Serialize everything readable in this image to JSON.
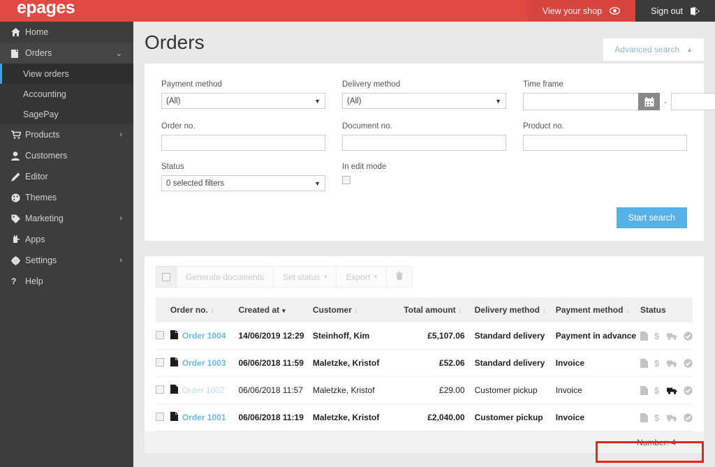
{
  "topbar": {
    "logo": "epages",
    "view_shop": "View your shop",
    "view_shop_icon": "eye-icon",
    "sign_out": "Sign out",
    "sign_out_icon": "sign-out-icon",
    "bg_color": "#e04a43"
  },
  "sidebar": {
    "items": [
      {
        "label": "Home",
        "icon": "home-icon",
        "chevron": ""
      },
      {
        "label": "Orders",
        "icon": "orders-icon",
        "chevron": "⌄"
      },
      {
        "label": "Products",
        "icon": "cart-icon",
        "chevron": "›"
      },
      {
        "label": "Customers",
        "icon": "user-icon",
        "chevron": ""
      },
      {
        "label": "Editor",
        "icon": "pencil-icon",
        "chevron": ""
      },
      {
        "label": "Themes",
        "icon": "palette-icon",
        "chevron": ""
      },
      {
        "label": "Marketing",
        "icon": "tag-icon",
        "chevron": "›"
      },
      {
        "label": "Apps",
        "icon": "plug-icon",
        "chevron": ""
      },
      {
        "label": "Settings",
        "icon": "gear-icon",
        "chevron": "›"
      },
      {
        "label": "Help",
        "icon": "question-icon",
        "chevron": ""
      }
    ],
    "suborders": [
      {
        "label": "View orders",
        "current": true
      },
      {
        "label": "Accounting",
        "current": false
      },
      {
        "label": "SagePay",
        "current": false
      }
    ]
  },
  "page": {
    "title": "Orders",
    "advanced_search": "Advanced search",
    "advanced_search_chevron": "▲"
  },
  "search": {
    "payment_method_label": "Payment method",
    "payment_method_value": "(All)",
    "delivery_method_label": "Delivery method",
    "delivery_method_value": "(All)",
    "time_frame_label": "Time frame",
    "time_frame_from": "",
    "time_frame_to": "",
    "time_frame_separator": "-",
    "calendar_icon": "calendar-icon",
    "order_no_label": "Order no.",
    "order_no_value": "",
    "document_no_label": "Document no.",
    "document_no_value": "",
    "product_no_label": "Product no.",
    "product_no_value": "",
    "status_label": "Status",
    "status_value": "0 selected filters",
    "in_edit_mode_label": "In edit mode",
    "in_edit_mode_checked": false,
    "start_search": "Start search",
    "primary_color": "#56b2e5"
  },
  "toolbar": {
    "select_all_icon": "checkbox-icon",
    "generate_documents": "Generate documents",
    "set_status": "Set status",
    "export": "Export",
    "delete_icon": "trash-icon",
    "caret": "▾"
  },
  "table": {
    "columns": [
      {
        "label": "Order no.",
        "sortable": true,
        "active": false
      },
      {
        "label": "Created at",
        "sortable": true,
        "active": true
      },
      {
        "label": "Customer",
        "sortable": true,
        "active": false
      },
      {
        "label": "Total amount",
        "sortable": true,
        "active": false
      },
      {
        "label": "Delivery method",
        "sortable": true,
        "active": false
      },
      {
        "label": "Payment method",
        "sortable": true,
        "active": false
      },
      {
        "label": "Status",
        "sortable": false,
        "active": false
      }
    ],
    "sort_glyph": "▾",
    "sort_glyph_inactive": "↕",
    "rows": [
      {
        "order_no": "Order 1004",
        "created_at": "14/06/2019 12:29",
        "customer": "Steinhoff, Kim",
        "total_amount": "£5,107.06",
        "delivery_method": "Standard delivery",
        "payment_method": "Payment in advance",
        "read": false,
        "status_icons": [
          {
            "name": "document-icon",
            "active": false
          },
          {
            "name": "dollar-icon",
            "active": false
          },
          {
            "name": "truck-icon",
            "active": false
          },
          {
            "name": "check-circle-icon",
            "active": false
          }
        ]
      },
      {
        "order_no": "Order 1003",
        "created_at": "06/06/2018 11:59",
        "customer": "Maletzke, Kristof",
        "total_amount": "£52.06",
        "delivery_method": "Standard delivery",
        "payment_method": "Invoice",
        "read": false,
        "status_icons": [
          {
            "name": "document-icon",
            "active": false
          },
          {
            "name": "dollar-icon",
            "active": false
          },
          {
            "name": "truck-icon",
            "active": false
          },
          {
            "name": "check-circle-icon",
            "active": false
          }
        ]
      },
      {
        "order_no": "Order 1002",
        "created_at": "06/06/2018 11:57",
        "customer": "Maletzke, Kristof",
        "total_amount": "£29.00",
        "delivery_method": "Customer pickup",
        "payment_method": "Invoice",
        "read": true,
        "status_icons": [
          {
            "name": "document-icon",
            "active": false
          },
          {
            "name": "dollar-icon",
            "active": false
          },
          {
            "name": "truck-icon",
            "active": true
          },
          {
            "name": "check-circle-icon",
            "active": false
          }
        ]
      },
      {
        "order_no": "Order 1001",
        "created_at": "06/06/2018 11:19",
        "customer": "Maletzke, Kristof",
        "total_amount": "£2,040.00",
        "delivery_method": "Customer pickup",
        "payment_method": "Invoice",
        "read": false,
        "status_icons": [
          {
            "name": "document-icon",
            "active": false
          },
          {
            "name": "dollar-icon",
            "active": false
          },
          {
            "name": "truck-icon",
            "active": false
          },
          {
            "name": "check-circle-icon",
            "active": false
          }
        ]
      }
    ],
    "footer_count": "Number: 4",
    "highlight_color": "#e8231e"
  }
}
